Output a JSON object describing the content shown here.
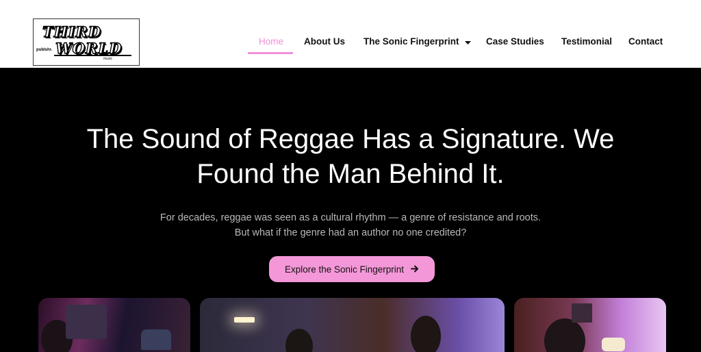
{
  "logo": {
    "line1": "THIRD",
    "line2": "WORLD",
    "small_left": "publshr.",
    "small_right": "music"
  },
  "nav": {
    "items": [
      {
        "label": "Home",
        "active": true
      },
      {
        "label": "About Us"
      },
      {
        "label": "The Sonic Fingerprint",
        "has_dropdown": true
      },
      {
        "label": "Case Studies"
      },
      {
        "label": "Testimonial"
      },
      {
        "label": "Contact"
      }
    ]
  },
  "hero": {
    "title_line1": "The Sound of Reggae Has a Signature. We",
    "title_line2": "Found the Man Behind It.",
    "subtitle_line1": "For decades, reggae was seen as a cultural rhythm — a genre of resistance and roots.",
    "subtitle_line2": "But what if the genre had an author no one credited?",
    "cta_label": "Explore the Sonic Fingerprint"
  },
  "colors": {
    "accent": "#f497d8",
    "active_nav": "#f08fd8",
    "hero_bg": "#000000"
  },
  "icons": [
    "chevron-down-icon",
    "arrow-right-icon"
  ]
}
